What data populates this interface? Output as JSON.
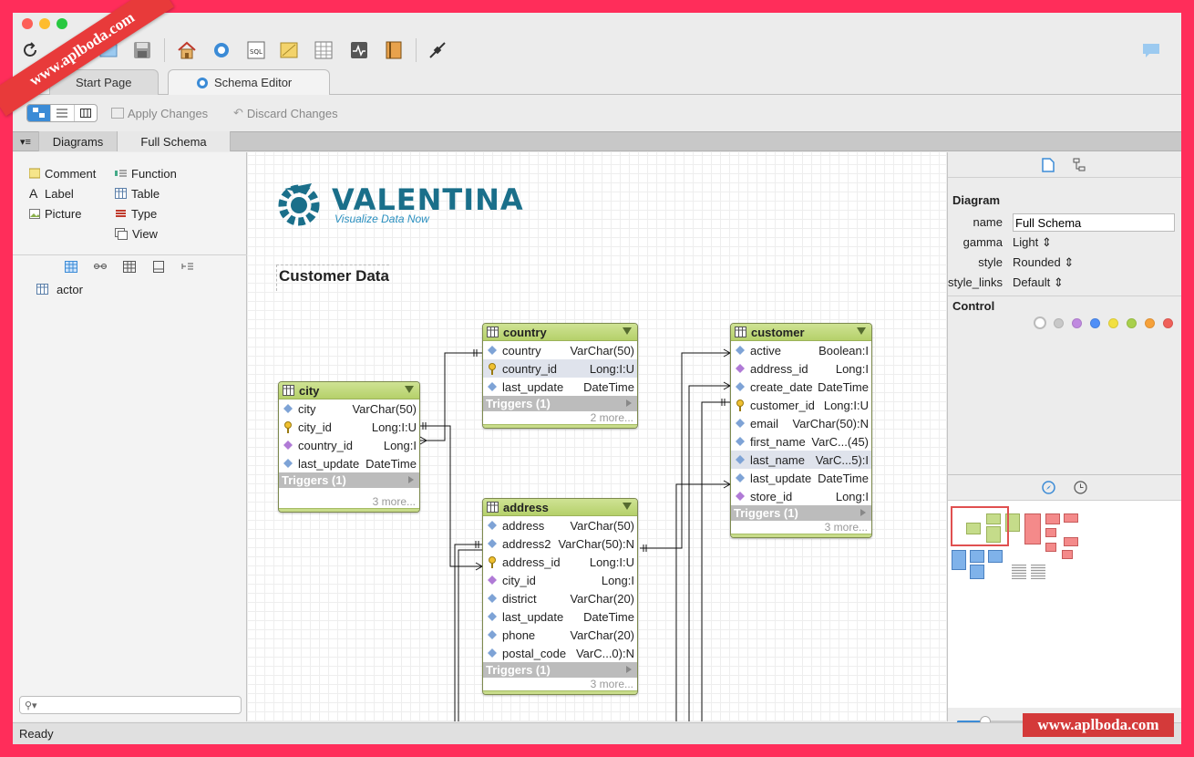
{
  "watermark": {
    "top": "www.aplboda.com",
    "bottom": "www.aplboda.com"
  },
  "tabs": [
    {
      "label": "Start Page"
    },
    {
      "label": "Schema Editor"
    }
  ],
  "subtoolbar": {
    "apply": "Apply Changes",
    "discard": "Discard Changes"
  },
  "left_tabs": {
    "diagrams": "Diagrams",
    "full_schema": "Full Schema"
  },
  "palette": {
    "comment": "Comment",
    "label": "Label",
    "picture": "Picture",
    "function": "Function",
    "table": "Table",
    "type": "Type",
    "view": "View"
  },
  "tree": {
    "item": "actor"
  },
  "search": {
    "placeholder": ""
  },
  "status": "Ready",
  "canvas": {
    "logo_name": "VALENTINA",
    "logo_tag": "Visualize Data Now",
    "title": "Customer Data"
  },
  "tables": {
    "country": {
      "name": "country",
      "rows": [
        {
          "name": "country",
          "type": "VarChar(50)",
          "icon": "diamond"
        },
        {
          "name": "country_id",
          "type": "Long:I:U",
          "icon": "key",
          "selected": true
        },
        {
          "name": "last_update",
          "type": "DateTime",
          "icon": "diamond"
        }
      ],
      "triggers": "Triggers (1)",
      "more": "2 more..."
    },
    "city": {
      "name": "city",
      "rows": [
        {
          "name": "city",
          "type": "VarChar(50)",
          "icon": "diamond"
        },
        {
          "name": "city_id",
          "type": "Long:I:U",
          "icon": "key"
        },
        {
          "name": "country_id",
          "type": "Long:I",
          "icon": "fk"
        },
        {
          "name": "last_update",
          "type": "DateTime",
          "icon": "diamond"
        }
      ],
      "triggers": "Triggers (1)",
      "more": "3 more..."
    },
    "address": {
      "name": "address",
      "rows": [
        {
          "name": "address",
          "type": "VarChar(50)",
          "icon": "diamond"
        },
        {
          "name": "address2",
          "type": "VarChar(50):N",
          "icon": "diamond"
        },
        {
          "name": "address_id",
          "type": "Long:I:U",
          "icon": "key"
        },
        {
          "name": "city_id",
          "type": "Long:I",
          "icon": "fk"
        },
        {
          "name": "district",
          "type": "VarChar(20)",
          "icon": "diamond"
        },
        {
          "name": "last_update",
          "type": "DateTime",
          "icon": "diamond"
        },
        {
          "name": "phone",
          "type": "VarChar(20)",
          "icon": "diamond"
        },
        {
          "name": "postal_code",
          "type": "VarC...0):N",
          "icon": "diamond"
        }
      ],
      "triggers": "Triggers (1)",
      "more": "3 more..."
    },
    "customer": {
      "name": "customer",
      "rows": [
        {
          "name": "active",
          "type": "Boolean:I",
          "icon": "diamond"
        },
        {
          "name": "address_id",
          "type": "Long:I",
          "icon": "fk"
        },
        {
          "name": "create_date",
          "type": "DateTime",
          "icon": "diamond"
        },
        {
          "name": "customer_id",
          "type": "Long:I:U",
          "icon": "key"
        },
        {
          "name": "email",
          "type": "VarChar(50):N",
          "icon": "diamond"
        },
        {
          "name": "first_name",
          "type": "VarC...(45)",
          "icon": "diamond"
        },
        {
          "name": "last_name",
          "type": "VarC...5):I",
          "icon": "diamond",
          "selected": true
        },
        {
          "name": "last_update",
          "type": "DateTime",
          "icon": "diamond"
        },
        {
          "name": "store_id",
          "type": "Long:I",
          "icon": "fk"
        }
      ],
      "triggers": "Triggers (1)",
      "more": "3 more..."
    }
  },
  "inspector": {
    "section_diagram": "Diagram",
    "name_label": "name",
    "name_value": "Full Schema",
    "gamma_label": "gamma",
    "gamma_value": "Light",
    "style_label": "style",
    "style_value": "Rounded",
    "style_links_label": "style_links",
    "style_links_value": "Default",
    "section_control": "Control",
    "colors": [
      "#ffffff",
      "#c8c8c8",
      "#c08ae0",
      "#4f8ff7",
      "#f2e040",
      "#a8d04c",
      "#f6a13a",
      "#f0605a"
    ]
  },
  "zoom_level": 0.15
}
